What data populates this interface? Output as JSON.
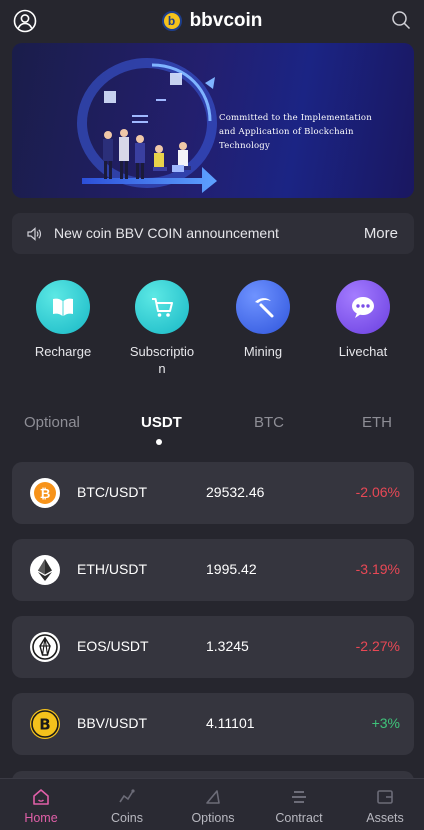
{
  "header": {
    "title": "bbvcoin",
    "logo_letter": "b",
    "icons": {
      "left": "user-icon",
      "right": "search-icon"
    }
  },
  "banner": {
    "line1": "Committed to the Implementation",
    "line2": "and Application of Blockchain",
    "line3": "Technology"
  },
  "announcement": {
    "icon": "speaker-icon",
    "text": "New coin BBV COIN announcement",
    "more": "More"
  },
  "actions": [
    {
      "label": "Recharge",
      "icon": "book-icon",
      "color": "#2ec8cf"
    },
    {
      "label": "Subscription",
      "icon": "cart-icon",
      "color": "#2ec8cf"
    },
    {
      "label": "Mining",
      "icon": "pickaxe-icon",
      "color": "#3a64e8"
    },
    {
      "label": "Livechat",
      "icon": "chat-icon",
      "color": "#7a4ee8"
    }
  ],
  "tabs": [
    {
      "label": "Optional",
      "active": false
    },
    {
      "label": "USDT",
      "active": true
    },
    {
      "label": "BTC",
      "active": false
    },
    {
      "label": "ETH",
      "active": false
    }
  ],
  "markets": [
    {
      "pair": "BTC/USDT",
      "price": "29532.46",
      "change": "-2.06%",
      "direction": "down",
      "icon": "bitcoin-icon"
    },
    {
      "pair": "ETH/USDT",
      "price": "1995.42",
      "change": "-3.19%",
      "direction": "down",
      "icon": "ethereum-icon"
    },
    {
      "pair": "EOS/USDT",
      "price": "1.3245",
      "change": "-2.27%",
      "direction": "down",
      "icon": "eos-icon"
    },
    {
      "pair": "BBV/USDT",
      "price": "4.11101",
      "change": "+3%",
      "direction": "up",
      "icon": "bbv-icon"
    }
  ],
  "bottom_nav": [
    {
      "label": "Home",
      "icon": "home-icon",
      "active": true
    },
    {
      "label": "Coins",
      "icon": "coins-icon",
      "active": false
    },
    {
      "label": "Options",
      "icon": "options-icon",
      "active": false
    },
    {
      "label": "Contract",
      "icon": "contract-icon",
      "active": false
    },
    {
      "label": "Assets",
      "icon": "wallet-icon",
      "active": false
    }
  ],
  "colors": {
    "background": "#26262e",
    "card": "#35353e",
    "down": "#e84855",
    "up": "#3fc37a",
    "nav_active": "#e05fa8"
  }
}
